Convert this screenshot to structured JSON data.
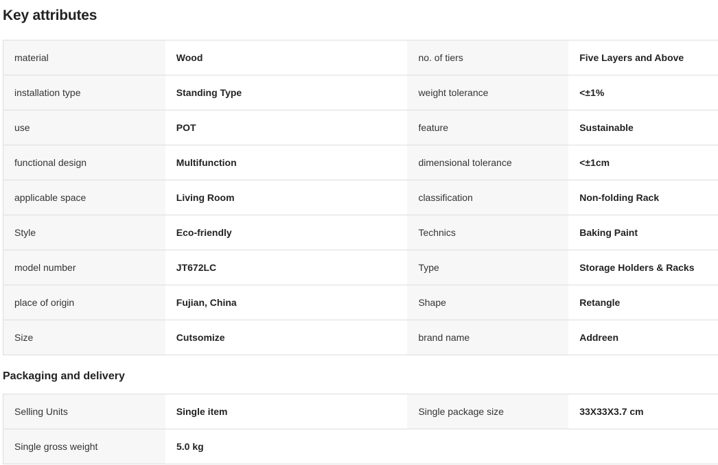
{
  "key_attributes": {
    "title": "Key attributes",
    "rows": [
      {
        "label1": "material",
        "value1": "Wood",
        "label2": "no. of tiers",
        "value2": "Five Layers and Above"
      },
      {
        "label1": "installation type",
        "value1": "Standing Type",
        "label2": "weight tolerance",
        "value2": "<±1%"
      },
      {
        "label1": "use",
        "value1": "POT",
        "label2": "feature",
        "value2": "Sustainable"
      },
      {
        "label1": "functional design",
        "value1": "Multifunction",
        "label2": "dimensional tolerance",
        "value2": "<±1cm"
      },
      {
        "label1": "applicable space",
        "value1": "Living Room",
        "label2": "classification",
        "value2": "Non-folding Rack"
      },
      {
        "label1": "Style",
        "value1": "Eco-friendly",
        "label2": "Technics",
        "value2": "Baking Paint"
      },
      {
        "label1": "model number",
        "value1": "JT672LC",
        "label2": "Type",
        "value2": "Storage Holders & Racks"
      },
      {
        "label1": "place of origin",
        "value1": "Fujian, China",
        "label2": "Shape",
        "value2": "Retangle"
      },
      {
        "label1": "Size",
        "value1": "Cutsomize",
        "label2": "brand name",
        "value2": "Addreen"
      }
    ]
  },
  "packaging": {
    "title": "Packaging and delivery",
    "rows": [
      {
        "label1": "Selling Units",
        "value1": "Single item",
        "label2": "Single package size",
        "value2": "33X33X3.7 cm"
      },
      {
        "label1": "Single gross weight",
        "value1": "5.0 kg",
        "label2": "",
        "value2": ""
      }
    ]
  },
  "colors": {
    "label_bg": "#f7f7f7",
    "value_bg": "#ffffff",
    "border": "#dddddd",
    "text": "#222222"
  }
}
